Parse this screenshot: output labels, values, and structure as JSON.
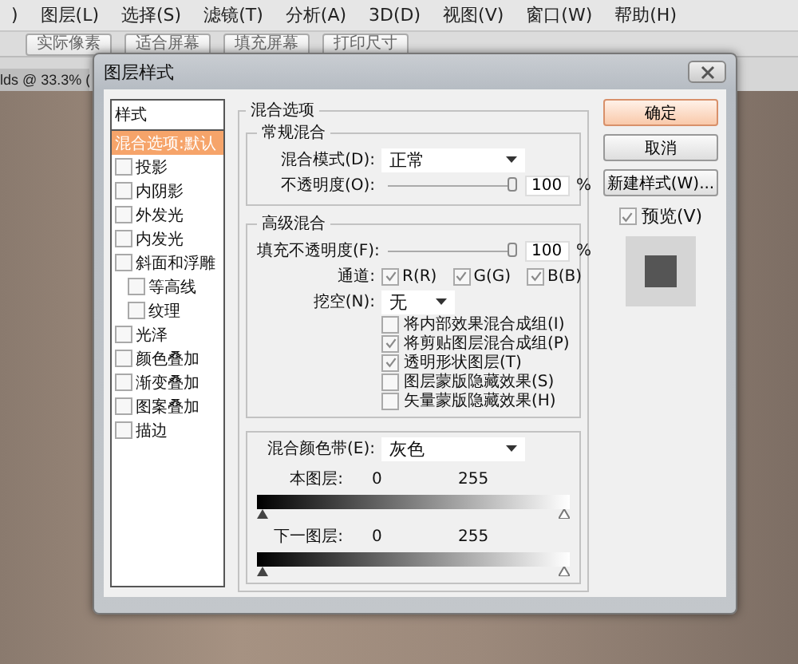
{
  "menu": [
    {
      "label": ")"
    },
    {
      "label": "图层(L)"
    },
    {
      "label": "选择(S)"
    },
    {
      "label": "滤镜(T)"
    },
    {
      "label": "分析(A)"
    },
    {
      "label": "3D(D)"
    },
    {
      "label": "视图(V)"
    },
    {
      "label": "窗口(W)"
    },
    {
      "label": "帮助(H)"
    }
  ],
  "toolbar": {
    "buttons": [
      {
        "label": "实际像素"
      },
      {
        "label": "适合屏幕"
      },
      {
        "label": "填充屏幕"
      },
      {
        "label": "打印尺寸"
      }
    ]
  },
  "document_tab": {
    "title": "lds @ 33.3% ("
  },
  "dialog": {
    "title": "图层样式",
    "styles": {
      "header": "样式",
      "items": [
        {
          "kind": "option",
          "label": "混合选项:默认",
          "selected": true
        },
        {
          "kind": "check",
          "label": "投影",
          "checked": false,
          "selected": false
        },
        {
          "kind": "check",
          "label": "内阴影",
          "checked": false,
          "selected": false
        },
        {
          "kind": "check",
          "label": "外发光",
          "checked": false,
          "selected": false
        },
        {
          "kind": "check",
          "label": "内发光",
          "checked": false,
          "selected": false
        },
        {
          "kind": "check",
          "label": "斜面和浮雕",
          "checked": false,
          "selected": false,
          "children": [
            {
              "kind": "check",
              "label": "等高线",
              "checked": false,
              "selected": false
            },
            {
              "kind": "check",
              "label": "纹理",
              "checked": false,
              "selected": false
            }
          ]
        },
        {
          "kind": "check",
          "label": "光泽",
          "checked": false,
          "selected": false
        },
        {
          "kind": "check",
          "label": "颜色叠加",
          "checked": false,
          "selected": false
        },
        {
          "kind": "check",
          "label": "渐变叠加",
          "checked": false,
          "selected": false
        },
        {
          "kind": "check",
          "label": "图案叠加",
          "checked": false,
          "selected": false
        },
        {
          "kind": "check",
          "label": "描边",
          "checked": false,
          "selected": false
        }
      ]
    },
    "blending": {
      "title": "混合选项",
      "general": {
        "title": "常规混合",
        "mode_label": "混合模式(D):",
        "mode": "正常",
        "opacity_label": "不透明度(O):",
        "opacity": {
          "level": 1,
          "value": "100",
          "unit": "%"
        }
      },
      "advanced": {
        "title": "高级混合",
        "fill_label": "填充不透明度(F):",
        "fill": {
          "level": 1,
          "value": "100",
          "unit": "%"
        },
        "channels_label": "通道:",
        "channels": [
          {
            "label": "R(R)",
            "checked": true
          },
          {
            "label": "G(G)",
            "checked": true
          },
          {
            "label": "B(B)",
            "checked": true
          }
        ],
        "knockout_label": "挖空(N):",
        "knockout": "无",
        "options": [
          {
            "label": "将内部效果混合成组(I)",
            "checked": false
          },
          {
            "label": "将剪贴图层混合成组(P)",
            "checked": true
          },
          {
            "label": "透明形状图层(T)",
            "checked": true
          },
          {
            "label": "图层蒙版隐藏效果(S)",
            "checked": false
          },
          {
            "label": "矢量蒙版隐藏效果(H)",
            "checked": false
          }
        ]
      },
      "blend_if": {
        "label": "混合颜色带(E):",
        "value": "灰色",
        "layers": [
          {
            "label": "本图层:",
            "low": "0",
            "high": "255"
          },
          {
            "label": "下一图层:",
            "low": "0",
            "high": "255"
          }
        ]
      }
    },
    "buttons": [
      {
        "label": "确定",
        "default": true
      },
      {
        "label": "取消",
        "default": false
      },
      {
        "label": "新建样式(W)...",
        "default": false
      }
    ],
    "preview": {
      "label": "预览(V)",
      "checked": true
    }
  }
}
